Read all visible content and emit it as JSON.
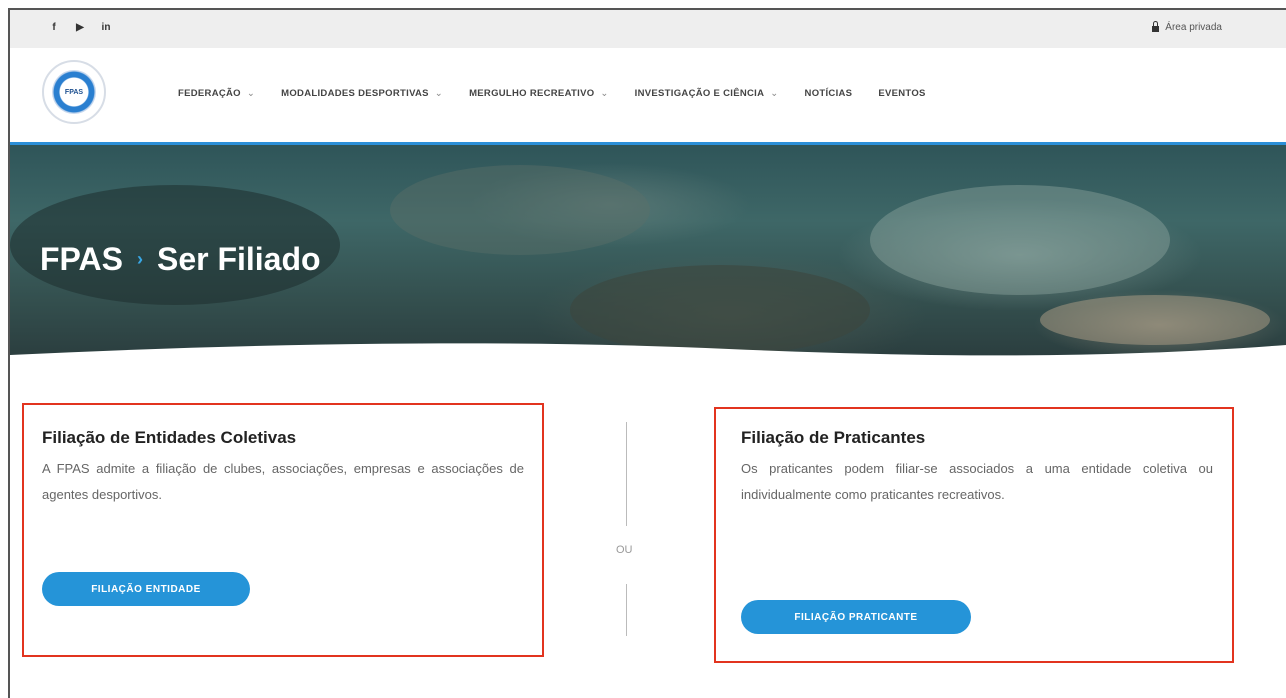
{
  "topbar": {
    "social": [
      {
        "icon": "facebook-icon",
        "glyph": "f"
      },
      {
        "icon": "youtube-icon",
        "glyph": "▶"
      },
      {
        "icon": "linkedin-icon",
        "glyph": "in"
      }
    ],
    "private_area": "Área privada"
  },
  "header": {
    "logo_text": "FPAS",
    "nav": [
      {
        "label": "FEDERAÇÃO",
        "dropdown": true
      },
      {
        "label": "MODALIDADES DESPORTIVAS",
        "dropdown": true
      },
      {
        "label": "MERGULHO RECREATIVO",
        "dropdown": true
      },
      {
        "label": "INVESTIGAÇÃO E CIÊNCIA",
        "dropdown": true
      },
      {
        "label": "NOTÍCIAS",
        "dropdown": false
      },
      {
        "label": "EVENTOS",
        "dropdown": false
      }
    ]
  },
  "hero": {
    "breadcrumb_root": "FPAS",
    "separator": "›",
    "page_title": "Ser Filiado"
  },
  "cards": {
    "entidades": {
      "title": "Filiação de Entidades Coletivas",
      "text": "A FPAS admite a filiação de clubes, associações, empresas e associações de agentes desportivos.",
      "button": "FILIAÇÃO ENTIDADE"
    },
    "divider_text": "OU",
    "praticantes": {
      "title": "Filiação de Praticantes",
      "text": "Os praticantes podem filiar-se associados a uma entidade coletiva ou individualmente como praticantes recreativos.",
      "button": "FILIAÇÃO PRATICANTE"
    }
  },
  "colors": {
    "accent": "#2594d8",
    "highlight_box": "#e2341f"
  }
}
